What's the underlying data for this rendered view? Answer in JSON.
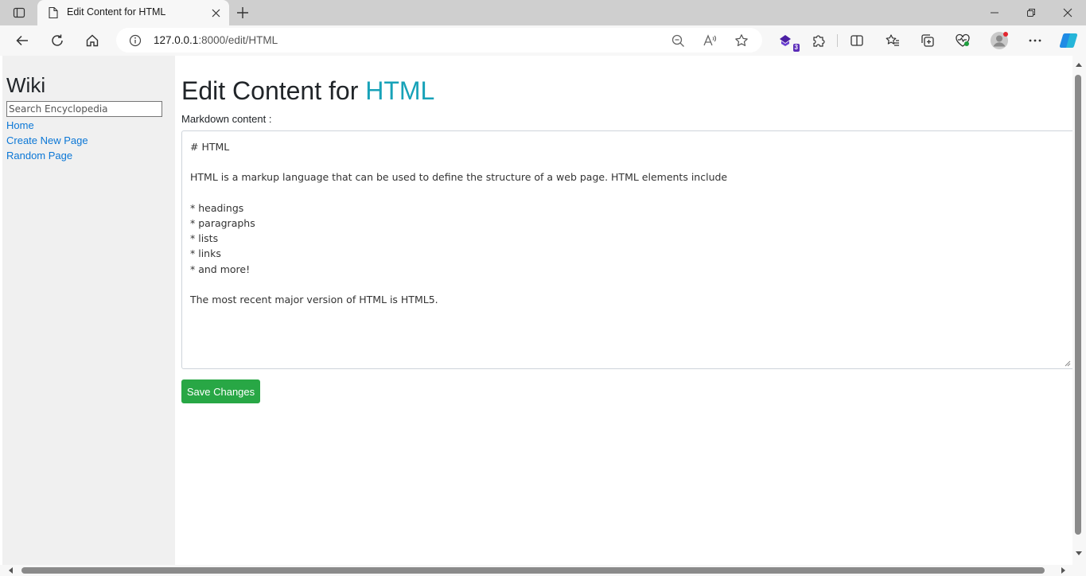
{
  "browser": {
    "tab": {
      "title": "Edit Content for HTML"
    },
    "address": {
      "host": "127.0.0.1",
      "path": ":8000/edit/HTML"
    },
    "extension_badge": "3",
    "icons": [
      "tab-actions-icon",
      "document-icon",
      "close-icon",
      "new-tab-icon",
      "minimize-icon",
      "restore-icon",
      "back-icon",
      "refresh-icon",
      "home-icon",
      "info-icon",
      "zoom-out-icon",
      "read-aloud-icon",
      "favorite-star-icon",
      "extension-icon",
      "puzzle-icon",
      "split-screen-icon",
      "favorites-icon",
      "collections-icon",
      "browser-essentials-icon",
      "profile-avatar-icon",
      "more-icon",
      "copilot-icon"
    ]
  },
  "sidebar": {
    "title": "Wiki",
    "search_placeholder": "Search Encyclopedia",
    "links": [
      "Home",
      "Create New Page",
      "Random Page"
    ]
  },
  "main": {
    "heading_prefix": "Edit Content for ",
    "heading_topic": "HTML",
    "label": "Markdown content :",
    "content_lines": [
      "# HTML",
      "",
      "HTML is a markup language that can be used to define the structure of a web page. HTML elements include",
      "",
      "* headings",
      "* paragraphs",
      "* lists",
      "* links",
      "* and more!",
      "",
      "The most recent major version of HTML is HTML5."
    ],
    "save_label": "Save Changes"
  },
  "colors": {
    "accent_link": "#0b77d6",
    "heading_topic": "#17a2b8",
    "save_button": "#28a745",
    "sidebar_bg": "#f0f0f0"
  }
}
